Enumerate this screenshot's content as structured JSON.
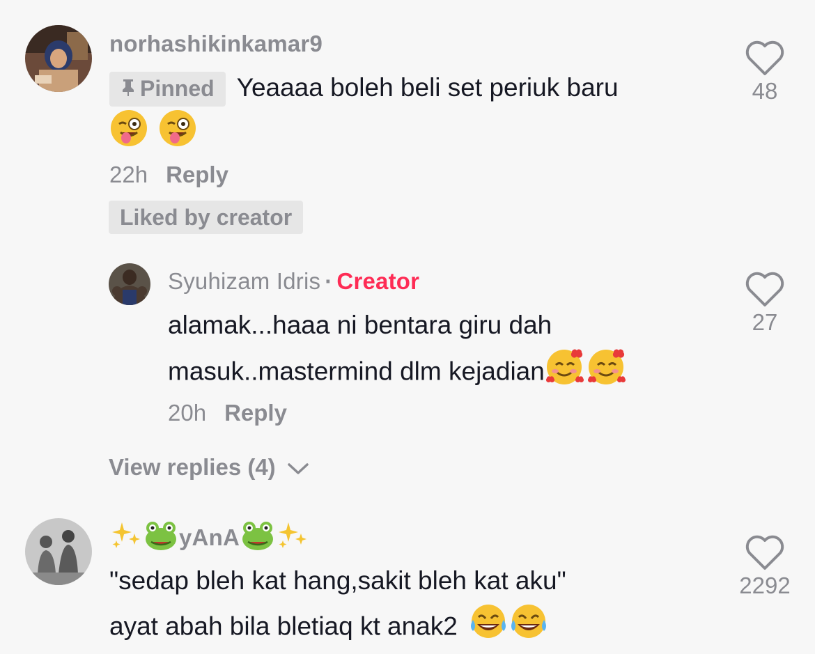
{
  "comments": [
    {
      "username": "norhashikinkamar9",
      "pinned_label": "Pinned",
      "text": "Yeaaaa boleh beli set periuk baru",
      "time": "22h",
      "reply_label": "Reply",
      "liked_by_label": "Liked by creator",
      "like_count": "48",
      "emoji": [
        "winking-tongue-emoji",
        "winking-tongue-emoji"
      ]
    },
    {
      "username": "Syuhizam Idris",
      "separator": "·",
      "badge": "Creator",
      "text_line1": "alamak...haaa ni bentara giru dah",
      "text_line2": "masuk..mastermind dlm kejadian",
      "time": "20h",
      "reply_label": "Reply",
      "like_count": "27",
      "emoji": [
        "smiling-hearts-emoji",
        "smiling-hearts-emoji"
      ]
    },
    {
      "username": "yAnA",
      "text_line1": "\"sedap bleh kat hang,sakit bleh kat aku\"",
      "text_line2": "ayat abah bila bletiaq kt anak2",
      "like_count": "2292",
      "emoji": [
        "tears-of-joy-emoji",
        "tears-of-joy-emoji"
      ]
    }
  ],
  "view_replies": "View replies (4)",
  "colors": {
    "accent": "#fe2c55",
    "muted": "#8a8b91",
    "text": "#161823",
    "background": "#f7f7f7"
  }
}
